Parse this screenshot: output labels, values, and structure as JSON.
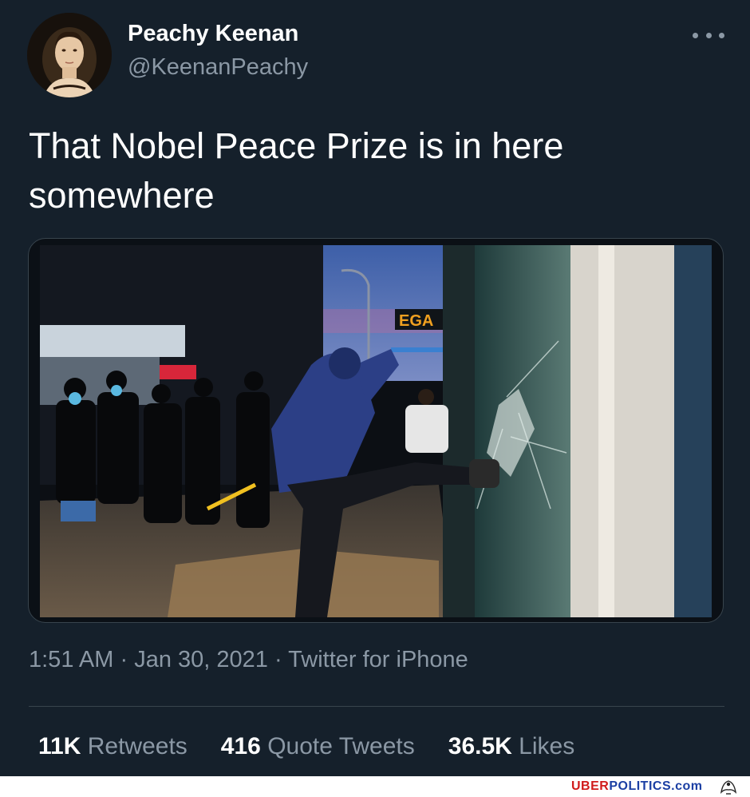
{
  "author": {
    "display_name": "Peachy Keenan",
    "handle": "@KeenanPeachy"
  },
  "menu_icon": "more-horizontal-icon",
  "tweet": {
    "text_line1": "That Nobel Peace Prize is in here",
    "text_line2": "somewhere",
    "media_alt_icon": "photo",
    "image_sign_text": "EGA"
  },
  "meta": {
    "time": "1:51 AM",
    "separator1": " · ",
    "date": "Jan 30, 2021",
    "separator2": " · ",
    "source": "Twitter for iPhone"
  },
  "stats": {
    "retweets": {
      "count": "11K",
      "label": "Retweets"
    },
    "quotes": {
      "count": "416",
      "label": "Quote Tweets"
    },
    "likes": {
      "count": "36.5K",
      "label": "Likes"
    }
  },
  "watermark": {
    "part1": "UBER",
    "part2": "POLITICS.com",
    "logo_icon": "eagle-icon"
  },
  "colors": {
    "background": "#15202b",
    "secondary_text": "#8b98a5",
    "divider": "#38444d",
    "watermark_red": "#d01b1b",
    "watermark_blue": "#1b3fa3"
  }
}
